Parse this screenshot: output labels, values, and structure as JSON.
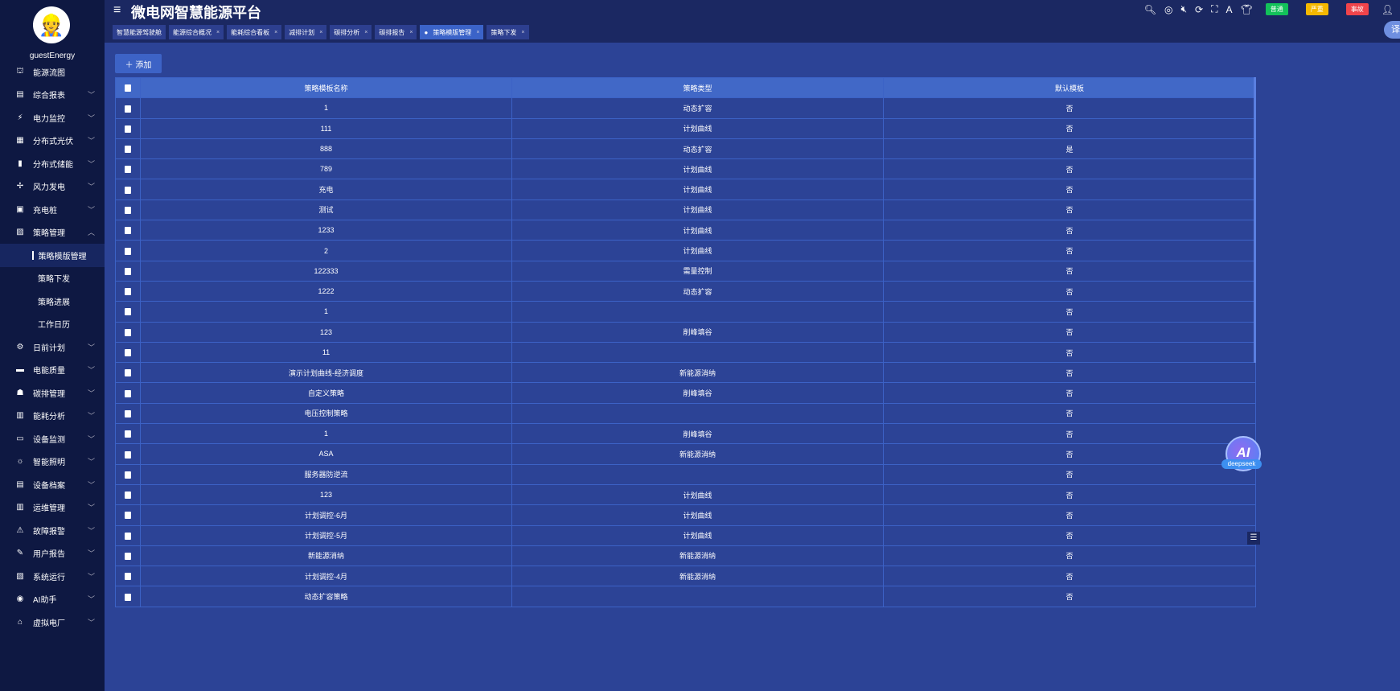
{
  "app": {
    "title": "微电网智慧能源平台",
    "user": "guestEnergy"
  },
  "sidebar": {
    "items": [
      {
        "label": "能源流图",
        "icon": "flow-icon",
        "chev": false
      },
      {
        "label": "综合报表",
        "icon": "report-icon",
        "chev": true
      },
      {
        "label": "电力监控",
        "icon": "power-icon",
        "chev": true
      },
      {
        "label": "分布式光伏",
        "icon": "solar-icon",
        "chev": true
      },
      {
        "label": "分布式储能",
        "icon": "battery-icon",
        "chev": true
      },
      {
        "label": "风力发电",
        "icon": "wind-icon",
        "chev": true
      },
      {
        "label": "充电桩",
        "icon": "charger-icon",
        "chev": true
      },
      {
        "label": "策略管理",
        "icon": "strategy-icon",
        "chev": true,
        "expanded": true
      }
    ],
    "subitems": [
      {
        "label": "策略模版管理",
        "active": true
      },
      {
        "label": "策略下发"
      },
      {
        "label": "策略进展"
      },
      {
        "label": "工作日历"
      }
    ],
    "items2": [
      {
        "label": "日前计划",
        "icon": "plan-icon"
      },
      {
        "label": "电能质量",
        "icon": "quality-icon"
      },
      {
        "label": "碳排管理",
        "icon": "carbon-icon"
      },
      {
        "label": "能耗分析",
        "icon": "chart-icon"
      },
      {
        "label": "设备监测",
        "icon": "monitor-icon"
      },
      {
        "label": "智能照明",
        "icon": "bulb-icon"
      },
      {
        "label": "设备档案",
        "icon": "archive-icon"
      },
      {
        "label": "运维管理",
        "icon": "maintenance-icon"
      },
      {
        "label": "故障报警",
        "icon": "alarm-icon"
      },
      {
        "label": "用户报告",
        "icon": "edit-icon"
      },
      {
        "label": "系统运行",
        "icon": "system-icon"
      },
      {
        "label": "AI助手",
        "icon": "ai-icon"
      },
      {
        "label": "虚拟电厂",
        "icon": "plant-icon"
      }
    ]
  },
  "tabs": [
    {
      "label": "智慧能源驾驶舱",
      "closable": false
    },
    {
      "label": "能源综合概况",
      "closable": true
    },
    {
      "label": "能耗综合看板",
      "closable": true
    },
    {
      "label": "减排计划",
      "closable": true
    },
    {
      "label": "碳排分析",
      "closable": true
    },
    {
      "label": "碳排报告",
      "closable": true
    },
    {
      "label": "策略模版管理",
      "closable": true,
      "active": true
    },
    {
      "label": "策略下发",
      "closable": true
    }
  ],
  "toolbar": {
    "badges": [
      {
        "label": "普通",
        "color": "#13c15a"
      },
      {
        "label": "严重",
        "color": "#f5b800"
      },
      {
        "label": "事故",
        "color": "#f0444b"
      }
    ],
    "translate": "译"
  },
  "main": {
    "add_label": "＋ 添加",
    "columns": [
      "策略模板名称",
      "策略类型",
      "默认模板"
    ],
    "rows": [
      [
        "1",
        "动态扩容",
        "否"
      ],
      [
        "111",
        "计划曲线",
        "否"
      ],
      [
        "888",
        "动态扩容",
        "是"
      ],
      [
        "789",
        "计划曲线",
        "否"
      ],
      [
        "充电",
        "计划曲线",
        "否"
      ],
      [
        "测试",
        "计划曲线",
        "否"
      ],
      [
        "1233",
        "计划曲线",
        "否"
      ],
      [
        "2",
        "计划曲线",
        "否"
      ],
      [
        "122333",
        "需量控制",
        "否"
      ],
      [
        "1222",
        "动态扩容",
        "否"
      ],
      [
        "1",
        "",
        "否"
      ],
      [
        "123",
        "削峰填谷",
        "否"
      ],
      [
        "11",
        "",
        "否"
      ],
      [
        "演示计划曲线-经济调度",
        "新能源消纳",
        "否"
      ],
      [
        "自定义策略",
        "削峰填谷",
        "否"
      ],
      [
        "电压控制策略",
        "",
        "否"
      ],
      [
        "1",
        "削峰填谷",
        "否"
      ],
      [
        "ASA",
        "新能源消纳",
        "否"
      ],
      [
        "服务器防逆流",
        "",
        "否"
      ],
      [
        "123",
        "计划曲线",
        "否"
      ],
      [
        "计划调控-6月",
        "计划曲线",
        "否"
      ],
      [
        "计划调控-5月",
        "计划曲线",
        "否"
      ],
      [
        "新能源消纳",
        "新能源消纳",
        "否"
      ],
      [
        "计划调控-4月",
        "新能源消纳",
        "否"
      ],
      [
        "动态扩容策略",
        "",
        "否"
      ]
    ]
  },
  "ai": {
    "label": "AI",
    "sub": "deepseek"
  }
}
